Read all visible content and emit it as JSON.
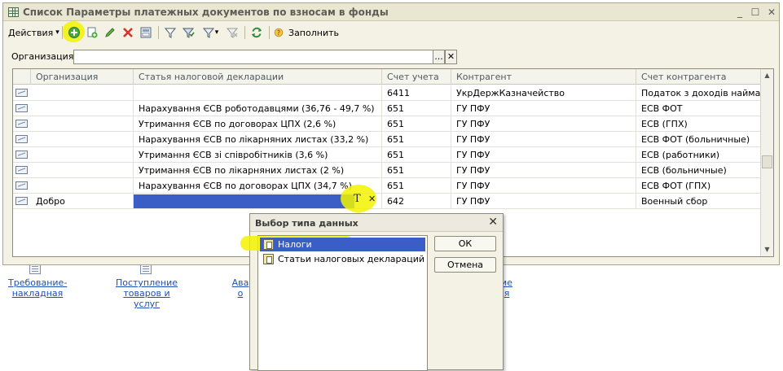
{
  "window": {
    "title": "Список Параметры платежных документов по взносам в фонды",
    "controls": {
      "minimize": "_",
      "maximize": "☐",
      "close": "✕"
    }
  },
  "toolbar": {
    "actions_label": "Действия",
    "dropdown_arrow": "▾",
    "fill_label": "Заполнить",
    "icons": [
      "add-icon",
      "copy-icon",
      "edit-icon",
      "delete-icon",
      "post-icon",
      "filter-icon",
      "filter-set-icon",
      "filter-menu-icon",
      "filter-clear-icon",
      "refresh-icon",
      "help-icon"
    ]
  },
  "filter": {
    "label": "Организация:",
    "value": "",
    "select_btn": "...",
    "clear_btn": "✕"
  },
  "grid": {
    "columns": [
      "Организация",
      "Статья налоговой декларации",
      "Счет учета",
      "Контрагент",
      "Счет контрагента"
    ],
    "rows": [
      {
        "org": "",
        "article": "",
        "account": "6411",
        "counterparty": "УкрДержКазначейство",
        "cp_account": "Податок з доходів найман..."
      },
      {
        "org": "",
        "article": "Нарахування ЄСВ роботодавцями (36,76 - 49,7 %)",
        "account": "651",
        "counterparty": "ГУ ПФУ",
        "cp_account": "ЕСВ ФОТ"
      },
      {
        "org": "",
        "article": "Утримання ЄСВ по договорах ЦПХ (2,6 %)",
        "account": "651",
        "counterparty": "ГУ ПФУ",
        "cp_account": "ЕСВ (ГПХ)"
      },
      {
        "org": "",
        "article": "Нарахування ЄСВ по лікарняних листах (33,2 %)",
        "account": "651",
        "counterparty": "ГУ ПФУ",
        "cp_account": "ЕСВ ФОТ (больничные)"
      },
      {
        "org": "",
        "article": "Утримання ЄСВ зі співробітників (3,6 %)",
        "account": "651",
        "counterparty": "ГУ ПФУ",
        "cp_account": "ЕСВ (работники)"
      },
      {
        "org": "",
        "article": "Утримання ЄСВ по лікарняних листах (2 %)",
        "account": "651",
        "counterparty": "ГУ ПФУ",
        "cp_account": "ЕСВ (больничные)"
      },
      {
        "org": "",
        "article": "Нарахування ЄСВ по договорах ЦПХ (34,7 %)",
        "account": "651",
        "counterparty": "ГУ ПФУ",
        "cp_account": "ЕСВ ФОТ (ГПХ)"
      },
      {
        "org": "Добро",
        "article": "",
        "account": "642",
        "counterparty": "ГУ ПФУ",
        "cp_account": "Военный сбор"
      }
    ],
    "edit_type_btn": "T",
    "edit_clear_btn": "✕"
  },
  "dialog": {
    "title": "Выбор типа данных",
    "close": "✕",
    "items": [
      "Налоги",
      "Статьи налоговых деклараций"
    ],
    "ok_label": "ОК",
    "cancel_label": "Отмена"
  },
  "background": {
    "links": [
      {
        "line1": "Требование-",
        "line2": "накладная"
      },
      {
        "line1": "Поступление",
        "line2": "товаров и услуг"
      },
      {
        "line1": "Ава",
        "line2": "о"
      },
      {
        "line1": "ие",
        "line2": "я"
      }
    ]
  },
  "colors": {
    "selection": "#3b5ec6",
    "highlight": "#f2f200",
    "window_bg": "#f4f2e4"
  }
}
